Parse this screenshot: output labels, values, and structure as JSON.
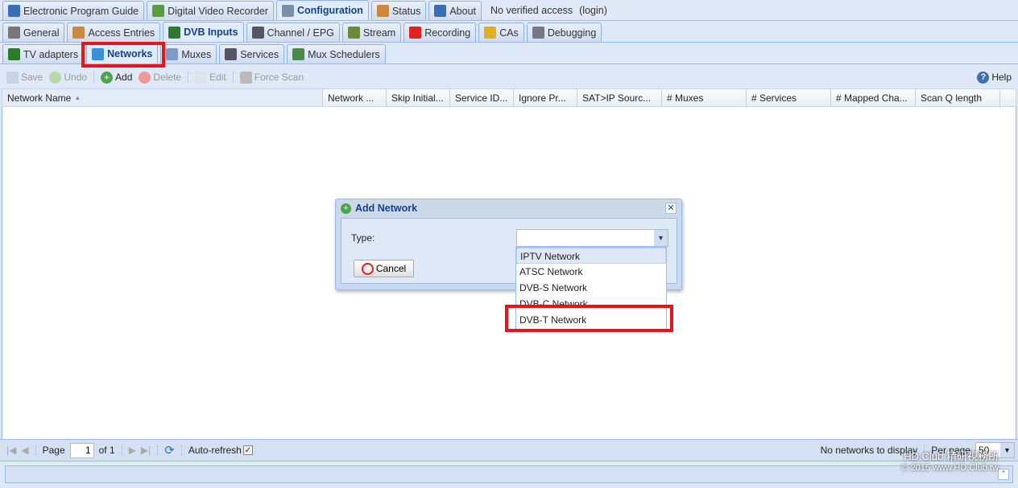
{
  "main_tabs": [
    {
      "label": "Electronic Program Guide",
      "icon": "epg-icon"
    },
    {
      "label": "Digital Video Recorder",
      "icon": "download-icon"
    },
    {
      "label": "Configuration",
      "icon": "wrench-icon",
      "active": true
    },
    {
      "label": "Status",
      "icon": "eye-icon"
    },
    {
      "label": "About",
      "icon": "info-icon"
    }
  ],
  "access": {
    "text": "No verified access",
    "login": "(login)"
  },
  "config_tabs": [
    {
      "label": "General",
      "icon": "tools-icon"
    },
    {
      "label": "Access Entries",
      "icon": "users-icon"
    },
    {
      "label": "DVB Inputs",
      "icon": "card-icon",
      "active": true
    },
    {
      "label": "Channel / EPG",
      "icon": "tv-icon"
    },
    {
      "label": "Stream",
      "icon": "film-icon"
    },
    {
      "label": "Recording",
      "icon": "rec-icon"
    },
    {
      "label": "CAs",
      "icon": "key-icon"
    },
    {
      "label": "Debugging",
      "icon": "gears-icon"
    }
  ],
  "dvb_tabs": [
    {
      "label": "TV adapters",
      "icon": "card-icon"
    },
    {
      "label": "Networks",
      "icon": "antenna-icon",
      "active": true
    },
    {
      "label": "Muxes",
      "icon": "monitor-icon"
    },
    {
      "label": "Services",
      "icon": "tv-icon"
    },
    {
      "label": "Mux Schedulers",
      "icon": "calendar-icon"
    }
  ],
  "toolbar": {
    "save": "Save",
    "undo": "Undo",
    "add": "Add",
    "delete": "Delete",
    "edit": "Edit",
    "force_scan": "Force Scan",
    "help": "Help"
  },
  "columns": [
    "Network Name",
    "Network ...",
    "Skip Initial...",
    "Service ID...",
    "Ignore Pr...",
    "SAT>IP Sourc...",
    "# Muxes",
    "# Services",
    "# Mapped Cha...",
    "Scan Q length"
  ],
  "dialog": {
    "title": "Add Network",
    "type_label": "Type:",
    "type_value": "",
    "cancel": "Cancel",
    "options": [
      "IPTV Network",
      "ATSC Network",
      "DVB-S Network",
      "DVB-C Network",
      "DVB-T Network"
    ]
  },
  "pager": {
    "page_label": "Page",
    "page": "1",
    "of": "of 1",
    "auto_refresh": "Auto-refresh",
    "status": "No networks to display",
    "per_page_label": "Per page",
    "per_page": "50"
  },
  "watermark": {
    "line1": "HD.Club 精研視務所",
    "line2": "© 2015  www.HD.Club.tw"
  },
  "colors": {
    "highlight": "#e8141c",
    "accent": "#15428b"
  }
}
